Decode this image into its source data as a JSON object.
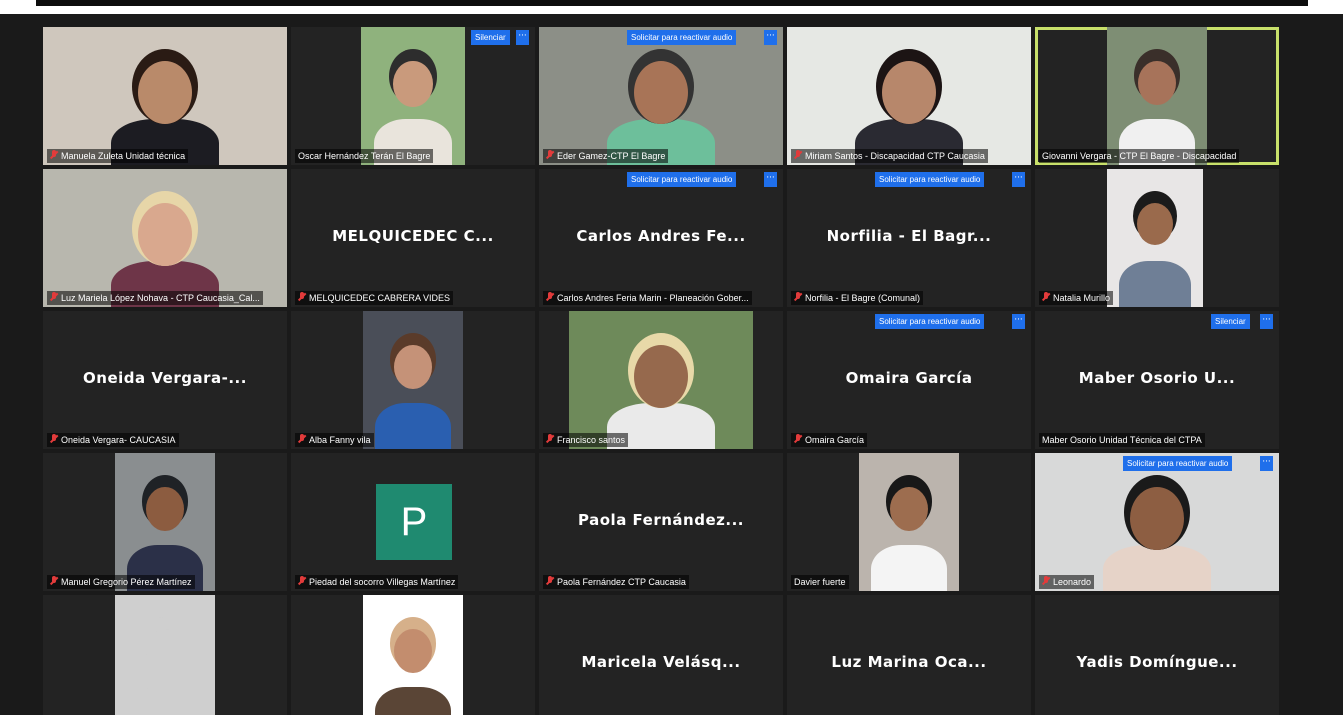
{
  "rows": [
    [
      {
        "id": "t00",
        "label": "Manuela Zuleta Unidad técnica",
        "muted": true,
        "video": true
      },
      {
        "id": "t01",
        "label": "Oscar Hernández Terán El Bagre",
        "muted": false,
        "video": true,
        "button": "Silenciar"
      },
      {
        "id": "t02",
        "label": "Eder Gamez-CTP El Bagre",
        "muted": true,
        "video": true,
        "button": "Solicitar para reactivar audio"
      },
      {
        "id": "t03",
        "label": "Miriam Santos - Discapacidad CTP Caucasia",
        "muted": true,
        "video": true
      },
      {
        "id": "t04",
        "label": "Giovanni Vergara - CTP El Bagre - Discapacidad",
        "muted": false,
        "video": true,
        "active": true
      }
    ],
    [
      {
        "id": "t10",
        "label": "Luz Mariela López Nohava - CTP Caucasia_Cal...",
        "muted": true,
        "video": true
      },
      {
        "id": "t11",
        "label": "MELQUICEDEC CABRERA VIDES",
        "muted": true,
        "big": "MELQUICEDEC C..."
      },
      {
        "id": "t12",
        "label": "Carlos Andres Feria Marin - Planeación Gober...",
        "muted": true,
        "big": "Carlos Andres Fe...",
        "button": "Solicitar para reactivar audio"
      },
      {
        "id": "t13",
        "label": "Norfilia - El Bagre (Comunal)",
        "muted": true,
        "big": "Norfilia - El Bagr...",
        "button": "Solicitar para reactivar audio"
      },
      {
        "id": "t14",
        "label": "Natalia Murillo",
        "muted": true,
        "video": true
      }
    ],
    [
      {
        "id": "t20",
        "label": "Oneida Vergara- CAUCASIA",
        "muted": true,
        "big": "Oneida Vergara-..."
      },
      {
        "id": "t21",
        "label": "Alba Fanny vila",
        "muted": true,
        "video": true
      },
      {
        "id": "t22",
        "label": "Francisco santos",
        "muted": true,
        "video": true
      },
      {
        "id": "t23",
        "label": "Omaira García",
        "muted": true,
        "big": "Omaira García",
        "button": "Solicitar para reactivar audio"
      },
      {
        "id": "t24",
        "label": "Maber Osorio Unidad Técnica del CTPA",
        "muted": false,
        "big": "Maber Osorio U...",
        "button": "Silenciar"
      }
    ],
    [
      {
        "id": "t30",
        "label": "Manuel Gregorio Pérez Martínez",
        "muted": true,
        "video": true
      },
      {
        "id": "t31",
        "label": "Piedad del socorro Villegas Martínez",
        "muted": true,
        "avatar": "P"
      },
      {
        "id": "t32",
        "label": "Paola Fernández CTP Caucasia",
        "muted": true,
        "big": "Paola Fernández..."
      },
      {
        "id": "t33",
        "label": "Davier fuerte",
        "muted": false,
        "video": true
      },
      {
        "id": "t34",
        "label": "Leonardo",
        "muted": true,
        "video": true,
        "button": "Solicitar para reactivar audio"
      }
    ],
    [
      {
        "id": "t40",
        "label": "",
        "muted": false,
        "video": true
      },
      {
        "id": "t41",
        "label": "",
        "muted": false,
        "video": true
      },
      {
        "id": "t42",
        "label": "",
        "muted": false,
        "big": "Maricela Velásq..."
      },
      {
        "id": "t43",
        "label": "",
        "muted": false,
        "big": "Luz Marina Oca..."
      },
      {
        "id": "t44",
        "label": "",
        "muted": false,
        "big": "Yadis Domíngue..."
      }
    ]
  ],
  "more_label": "···",
  "colors": {
    "accent": "#1f6feb",
    "active_border": "#c8e06a",
    "muted": "#e23b3b",
    "avatar": "#1f8a70"
  }
}
